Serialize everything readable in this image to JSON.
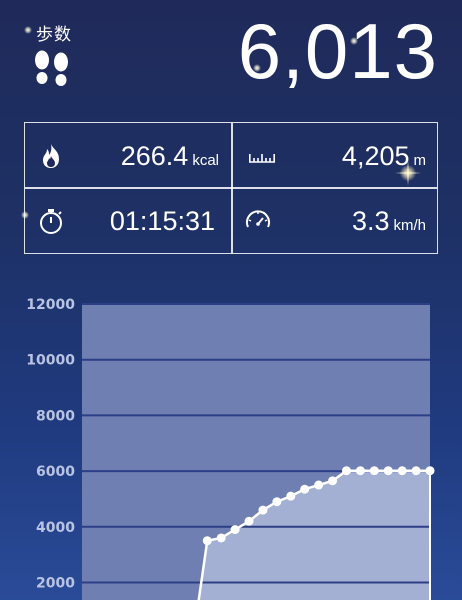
{
  "header": {
    "steps_label": "歩数",
    "steps_value": "6,013",
    "shoes_icon": "footprints-icon"
  },
  "stats": [
    {
      "icon": "flame-icon",
      "value": "266.4",
      "unit": "kcal"
    },
    {
      "icon": "ruler-icon",
      "value": "4,205",
      "unit": "m"
    },
    {
      "icon": "stopwatch-icon",
      "value": "01:15:31",
      "unit": ""
    },
    {
      "icon": "speedometer-icon",
      "value": "3.3",
      "unit": "km/h"
    }
  ],
  "colors": {
    "background_top": "#1f2a5a",
    "background_bottom": "#2a4b98",
    "plot_area": "#6f7fb2",
    "area_fill": "#a3afd3",
    "gridline": "#2c3f86",
    "tick_text": "#b9c3e3"
  },
  "chart_data": {
    "type": "area",
    "yticks": [
      "12000",
      "10000",
      "8000",
      "6000",
      "4000",
      "2000"
    ],
    "ylim": [
      0,
      12000
    ],
    "grid": true,
    "legend": "none",
    "series": [
      {
        "values": [
          0,
          0,
          0,
          0,
          0,
          0,
          0,
          0,
          0,
          3500,
          3600,
          3900,
          4200,
          4600,
          4900,
          5100,
          5350,
          5500,
          5650,
          6013,
          6013,
          6013,
          6013,
          6013,
          6013,
          6013
        ]
      }
    ],
    "line_start_value": 0,
    "first_marker_index": 9
  }
}
